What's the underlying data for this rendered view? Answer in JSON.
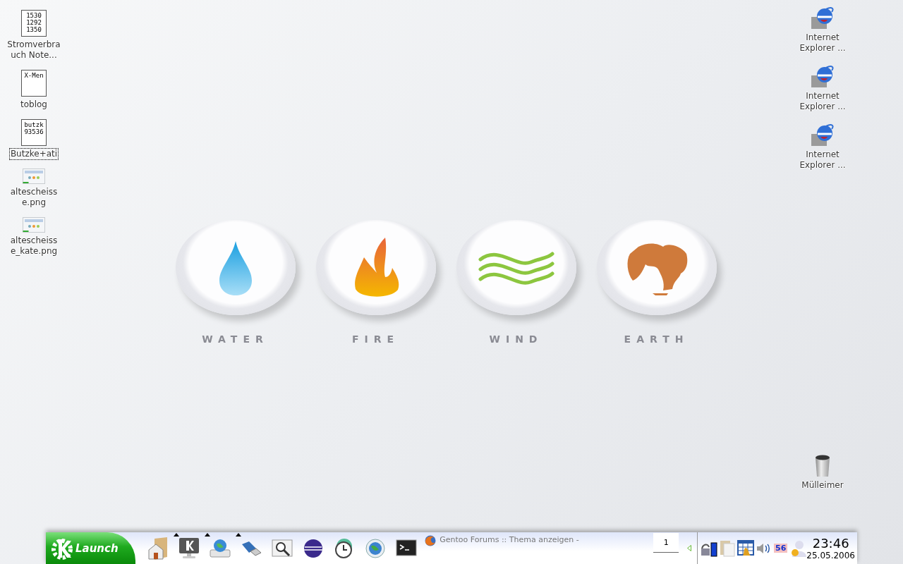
{
  "desktop_icons_left": [
    {
      "label": "Stromverbra uch Note...",
      "kind": "text",
      "preview": "1530 1292 1350",
      "selected": false
    },
    {
      "label": "toblog",
      "kind": "text",
      "preview": "X-Men",
      "selected": false
    },
    {
      "label": "Butzke+ati",
      "kind": "text",
      "preview": "butzk 93536",
      "selected": true
    },
    {
      "label": "altescheiss e.png",
      "kind": "image",
      "selected": false
    },
    {
      "label": "altescheiss e_kate.png",
      "kind": "image",
      "selected": false
    }
  ],
  "desktop_icons_right": [
    {
      "label": "Internet Explorer ...",
      "kind": "link"
    },
    {
      "label": "Internet Explorer ...",
      "kind": "link"
    },
    {
      "label": "Internet Explorer ...",
      "kind": "link"
    }
  ],
  "trash": {
    "label": "Mülleimer"
  },
  "wallpaper": {
    "elements": [
      {
        "kind": "water",
        "label": "WATER"
      },
      {
        "kind": "fire",
        "label": "FIRE"
      },
      {
        "kind": "wind",
        "label": "WIND"
      },
      {
        "kind": "earth",
        "label": "EARTH"
      }
    ]
  },
  "taskbar": {
    "launch_button": {
      "label": "Launch"
    },
    "quick_launch": [
      {
        "kind": "home",
        "has_menu": false
      },
      {
        "kind": "kde",
        "has_menu": true
      },
      {
        "kind": "network",
        "has_menu": true
      },
      {
        "kind": "usb",
        "has_menu": true
      },
      {
        "kind": "search",
        "has_menu": false
      },
      {
        "kind": "eclipse",
        "has_menu": false
      },
      {
        "kind": "clock",
        "has_menu": false
      },
      {
        "kind": "browser",
        "has_menu": false
      },
      {
        "kind": "terminal",
        "has_menu": false
      }
    ],
    "tasks": [
      {
        "title": "Gentoo Forums :: Thema anzeigen -"
      }
    ],
    "pager": {
      "desktop": "1"
    },
    "tray": [
      {
        "kind": "battery"
      },
      {
        "kind": "clipboard"
      },
      {
        "kind": "calendar"
      },
      {
        "kind": "volume"
      },
      {
        "kind": "counter",
        "text": "56"
      },
      {
        "kind": "messenger"
      }
    ],
    "clock": {
      "time": "23:46",
      "date": "25.05.2006"
    }
  }
}
